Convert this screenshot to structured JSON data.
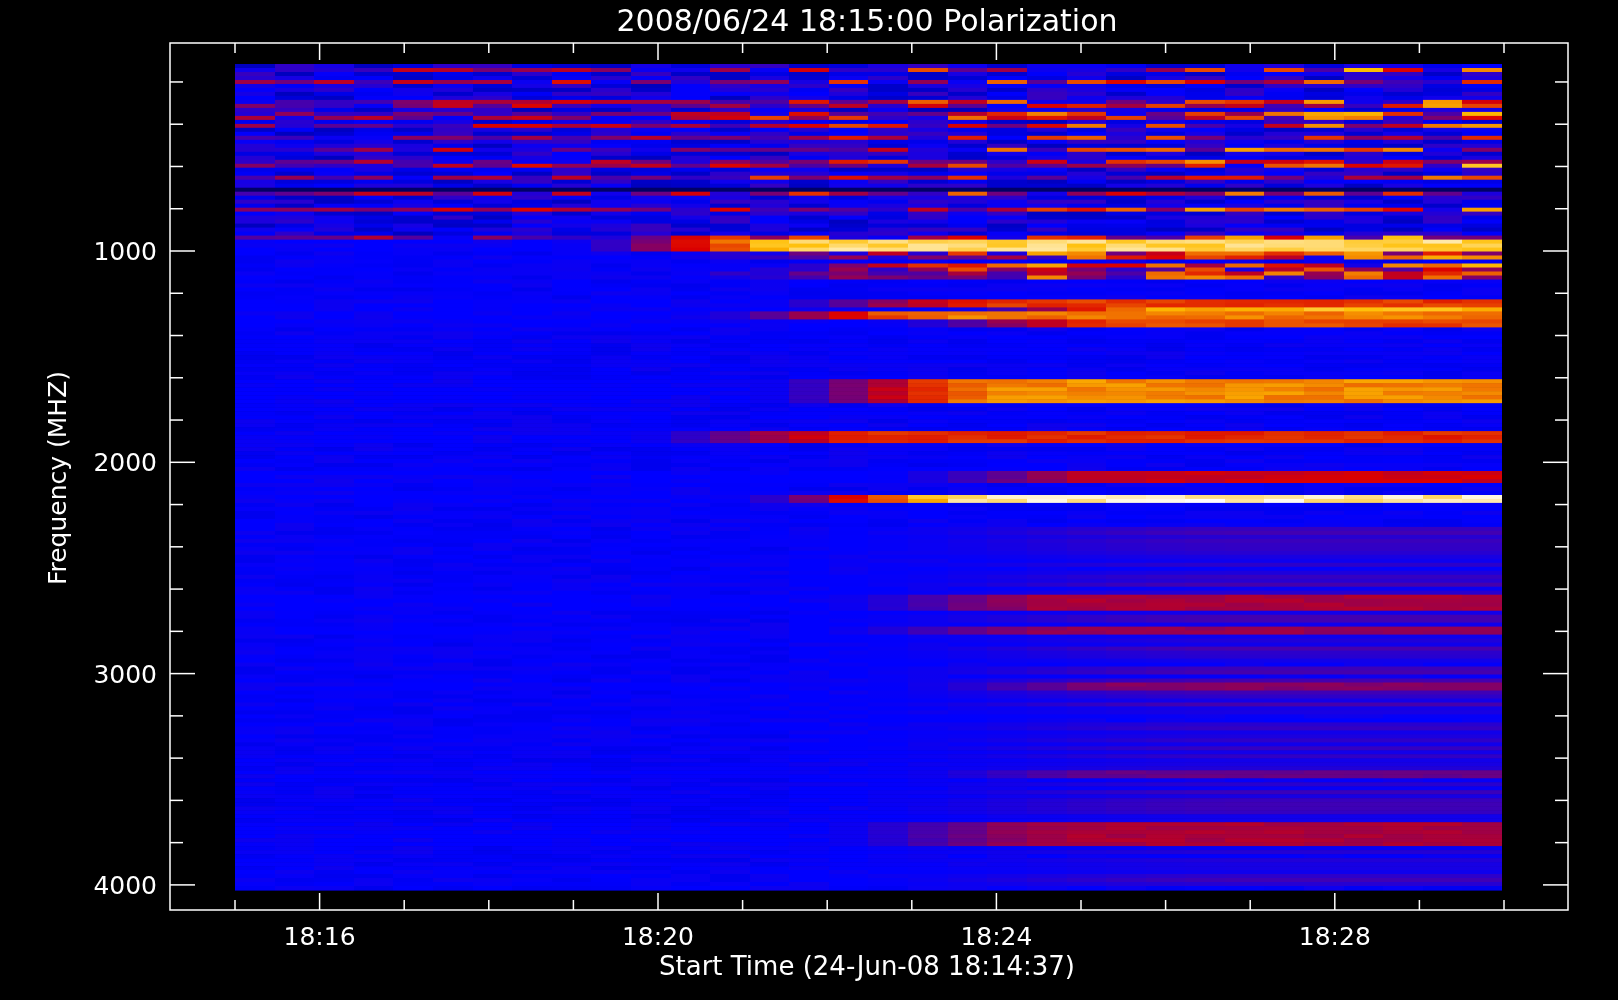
{
  "title": "2008/06/24 18:15:00 Polarization",
  "ylabel": "Frequency (MHZ)",
  "xlabel": "Start Time (24-Jun-08 18:14:37)",
  "yticks": [
    "1000",
    "2000",
    "3000",
    "4000"
  ],
  "xticks": [
    "18:16",
    "18:20",
    "18:24",
    "18:28"
  ]
}
